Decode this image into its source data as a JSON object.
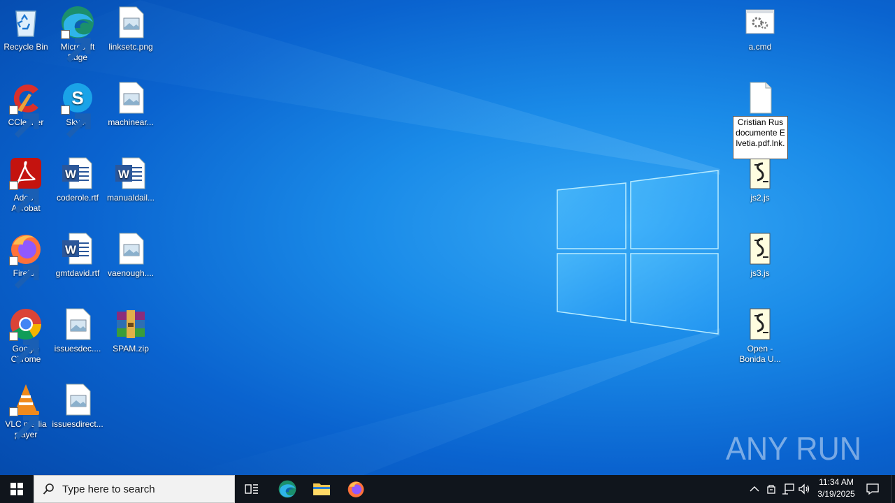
{
  "desktop": {
    "icons": [
      {
        "label": "Recycle Bin"
      },
      {
        "label": "Microsoft Edge"
      },
      {
        "label": "linksetc.png"
      },
      {
        "label": "CCleaner"
      },
      {
        "label": "Skype"
      },
      {
        "label": "machinear..."
      },
      {
        "label": "Adobe Acrobat"
      },
      {
        "label": "coderole.rtf"
      },
      {
        "label": "manualdail..."
      },
      {
        "label": "Firefox"
      },
      {
        "label": "gmtdavid.rtf"
      },
      {
        "label": "vaenough...."
      },
      {
        "label": "Google Chrome"
      },
      {
        "label": "issuesdec...."
      },
      {
        "label": "SPAM.zip"
      },
      {
        "label": "VLC media player"
      },
      {
        "label": "issuesdirect..."
      },
      {
        "label": "a.cmd"
      },
      {
        "label": "js2.js"
      },
      {
        "label": "js3.js"
      },
      {
        "label": "Open - Bonida U..."
      }
    ],
    "rename_value": "Cristian Rus documente Elvetia.pdf.lnk."
  },
  "watermark": {
    "text": "ANY RUN"
  },
  "taskbar": {
    "search_placeholder": "Type here to search",
    "clock_time": "11:34 AM",
    "clock_date": "3/19/2025"
  }
}
